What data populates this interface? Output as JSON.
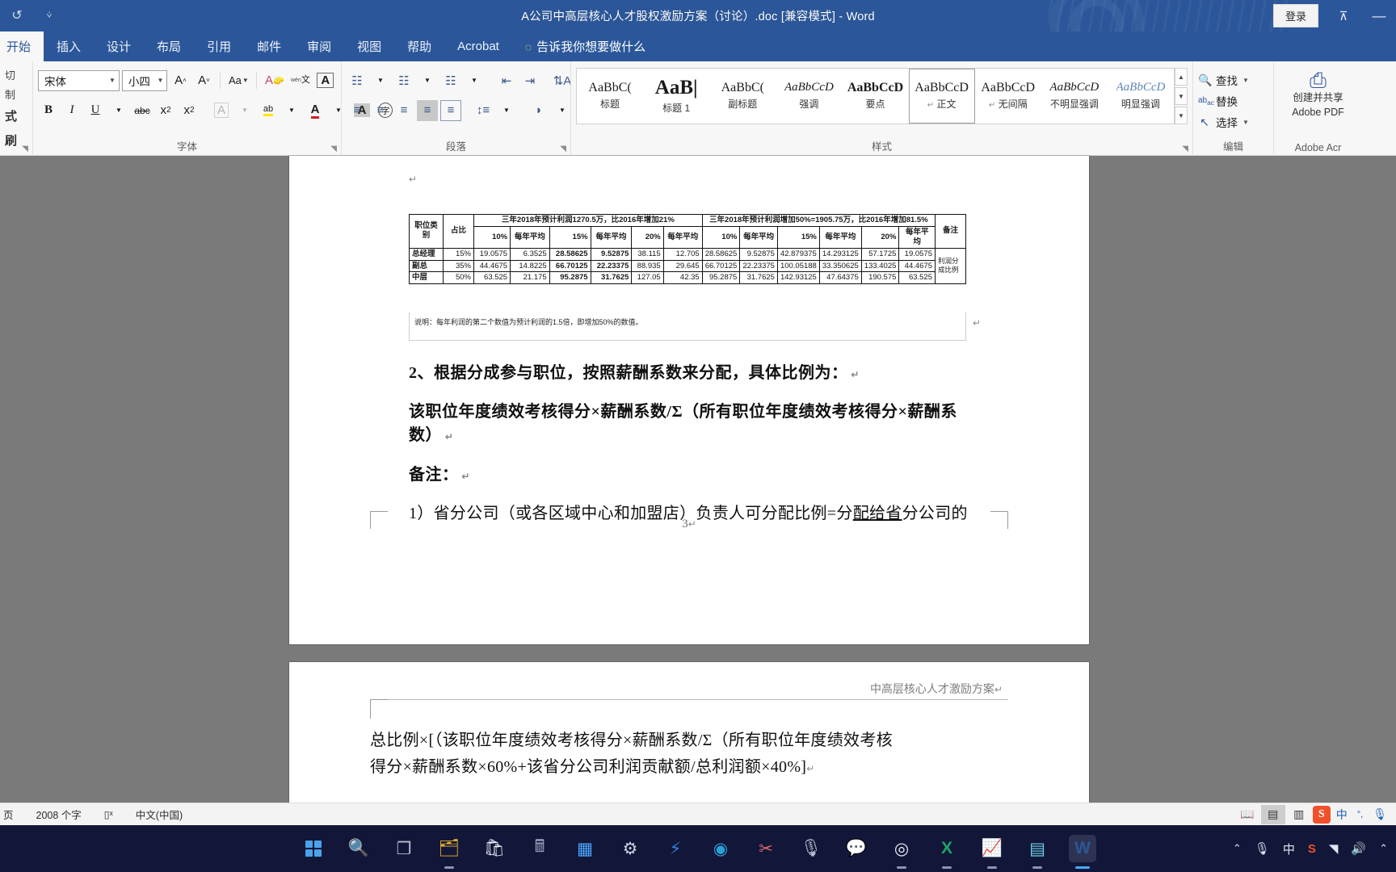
{
  "titlebar": {
    "document_title": "A公司中高层核心人才股权激励方案（讨论）.doc [兼容模式]  -  Word",
    "signin_label": "登录",
    "qat": [
      {
        "name": "undo",
        "glyph": "↺"
      },
      {
        "name": "customize",
        "glyph": "⩒"
      }
    ],
    "ribbon_display_glyph": "⊼",
    "minimize_glyph": "—"
  },
  "tabs": [
    {
      "label": "开始",
      "active": true
    },
    {
      "label": "插入",
      "active": false
    },
    {
      "label": "设计",
      "active": false
    },
    {
      "label": "布局",
      "active": false
    },
    {
      "label": "引用",
      "active": false
    },
    {
      "label": "邮件",
      "active": false
    },
    {
      "label": "审阅",
      "active": false
    },
    {
      "label": "视图",
      "active": false
    },
    {
      "label": "帮助",
      "active": false
    },
    {
      "label": "Acrobat",
      "active": false
    }
  ],
  "tell_me": "告诉我你想要做什么",
  "ribbon": {
    "clipboard": {
      "label": "",
      "items": [
        "切",
        "制",
        "式刷"
      ]
    },
    "font": {
      "label": "字体",
      "font_name": "宋体",
      "font_size": "小四",
      "buttons": [
        {
          "name": "grow-font",
          "glyph": "A˄"
        },
        {
          "name": "shrink-font",
          "glyph": "A˅"
        },
        {
          "name": "change-case",
          "glyph": "Aa"
        },
        {
          "name": "clear-formatting",
          "glyph": "A"
        },
        {
          "name": "phonetic-guide",
          "glyph": "文"
        },
        {
          "name": "character-border",
          "glyph": "A"
        },
        {
          "name": "bold",
          "glyph": "B"
        },
        {
          "name": "italic",
          "glyph": "I"
        },
        {
          "name": "underline",
          "glyph": "U"
        },
        {
          "name": "strikethrough",
          "glyph": "abc"
        },
        {
          "name": "subscript",
          "glyph": "x₂"
        },
        {
          "name": "superscript",
          "glyph": "x²"
        },
        {
          "name": "text-effects",
          "glyph": "A"
        },
        {
          "name": "text-highlight-color",
          "glyph": "ab"
        },
        {
          "name": "font-color",
          "glyph": "A"
        },
        {
          "name": "character-shading",
          "glyph": "A"
        },
        {
          "name": "enclose-characters",
          "glyph": "字"
        }
      ]
    },
    "paragraph": {
      "label": "段落",
      "buttons": [
        {
          "name": "bullets",
          "glyph": "☰"
        },
        {
          "name": "numbering",
          "glyph": "☰"
        },
        {
          "name": "multilevel-list",
          "glyph": "☰"
        },
        {
          "name": "decrease-indent",
          "glyph": "⇤"
        },
        {
          "name": "increase-indent",
          "glyph": "⇥"
        },
        {
          "name": "sort",
          "glyph": "A↓"
        },
        {
          "name": "show-formatting-marks",
          "glyph": "¶"
        },
        {
          "name": "align-left",
          "glyph": "≡"
        },
        {
          "name": "align-center",
          "glyph": "≡"
        },
        {
          "name": "align-right",
          "glyph": "≡"
        },
        {
          "name": "justify",
          "glyph": "≡"
        },
        {
          "name": "distribute",
          "glyph": "≡"
        },
        {
          "name": "line-spacing",
          "glyph": "↕"
        },
        {
          "name": "shading",
          "glyph": "◗"
        },
        {
          "name": "borders",
          "glyph": "▢"
        }
      ]
    },
    "styles": {
      "label": "样式",
      "gallery": [
        {
          "preview": "AaBbC(",
          "name": "标题",
          "kind": "norm",
          "selected": false,
          "pilcrow": false
        },
        {
          "preview": "AaB|",
          "name": "标题 1",
          "kind": "big",
          "selected": false,
          "pilcrow": false
        },
        {
          "preview": "AaBbC(",
          "name": "副标题",
          "kind": "norm",
          "selected": false,
          "pilcrow": false
        },
        {
          "preview": "AaBbCcD",
          "name": "强调",
          "kind": "ital",
          "selected": false,
          "pilcrow": false
        },
        {
          "preview": "AaBbCcD",
          "name": "要点",
          "kind": "bolds",
          "selected": false,
          "pilcrow": false
        },
        {
          "preview": "AaBbCcD",
          "name": "正文",
          "kind": "norm",
          "selected": true,
          "pilcrow": true
        },
        {
          "preview": "AaBbCcD",
          "name": "无间隔",
          "kind": "norm",
          "selected": false,
          "pilcrow": true
        },
        {
          "preview": "AaBbCcD",
          "name": "不明显强调",
          "kind": "ital",
          "selected": false,
          "pilcrow": false
        },
        {
          "preview": "AaBbCcD",
          "name": "明显强调",
          "kind": "blueital",
          "selected": false,
          "pilcrow": false
        }
      ]
    },
    "editing": {
      "label": "编辑",
      "items": [
        {
          "icon": "search-icon",
          "glyph": "🔍",
          "label": "查找",
          "caret": true
        },
        {
          "icon": "replace-icon",
          "glyph": "ab",
          "label": "替换",
          "caret": false
        },
        {
          "icon": "select-icon",
          "glyph": "↖",
          "label": "选择",
          "caret": true
        }
      ]
    },
    "adobe": {
      "label": "Adobe Acr",
      "line1": "创建并共享",
      "line2": "Adobe PDF"
    }
  },
  "document": {
    "table": {
      "headers": {
        "col_category": "职位类别",
        "col_share": "占比",
        "group_left": "三年2018年预计利润1270.5万，比2016年增加21%",
        "group_right": "三年2018年预计利润增加50%=1905.75万，比2016年增加81.5%",
        "col_remark": "备注",
        "remark_sub": "利润分成比例",
        "sub_cols": [
          "10%",
          "每年平均",
          "15%",
          "每年平均",
          "20%",
          "每年平均"
        ]
      },
      "rows": [
        {
          "category": "总经理",
          "share": "15%",
          "left": [
            "19.0575",
            "6.3525",
            "28.58625",
            "9.52875",
            "38.115",
            "12.705"
          ],
          "right": [
            "28.58625",
            "9.52875",
            "42.879375",
            "14.293125",
            "57.1725",
            "19.0575"
          ]
        },
        {
          "category": "副总",
          "share": "35%",
          "left": [
            "44.4675",
            "14.8225",
            "66.70125",
            "22.23375",
            "88.935",
            "29.645"
          ],
          "right": [
            "66.70125",
            "22.23375",
            "100.05188",
            "33.350625",
            "133.4025",
            "44.4675"
          ]
        },
        {
          "category": "中层",
          "share": "50%",
          "left": [
            "63.525",
            "21.175",
            "95.2875",
            "31.7625",
            "127.05",
            "42.35"
          ],
          "right": [
            "95.2875",
            "31.7625",
            "142.93125",
            "47.64375",
            "190.575",
            "63.525"
          ]
        }
      ],
      "note": "说明：每年利润的第二个数值为预计利润的1.5倍，即增加50%的数值。"
    },
    "paragraphs": [
      {
        "name": "heading-2",
        "text": "2、根据分成参与职位，按照薪酬系数来分配，具体比例为：",
        "bold": true
      },
      {
        "name": "formula-1",
        "text": "该职位年度绩效考核得分×薪酬系数/Σ（所有职位年度绩效考核得分×薪酬系数）",
        "bold": true
      },
      {
        "name": "remark-heading",
        "text": "备注：",
        "bold": true
      },
      {
        "name": "remark-item-1a",
        "text": "1）省分公司（或各区域中心和加盟店）负责人可分配比例=分",
        "bold": false
      },
      {
        "name": "remark-item-1b",
        "text": "配给省",
        "bold": false,
        "underline": true
      },
      {
        "name": "remark-item-1c",
        "text": "分公司的",
        "bold": false
      }
    ],
    "page_number": "3",
    "page2_header": "中高层核心人才激励方案",
    "page2_paragraphs": [
      {
        "name": "formula-2-line1",
        "text": "总比例×[（该职位年度绩效考核得分×薪酬系数/Σ（所有职位年度绩效考核"
      },
      {
        "name": "formula-2-line2",
        "text": "得分×薪酬系数×60%+该省分公司利润贡献额/总利润额×40%]"
      }
    ],
    "pilcrow": "↵"
  },
  "statusbar": {
    "page_label": "页",
    "word_count": "2008 个字",
    "proofing_icon": "spell-check-icon",
    "language": "中文(中国)",
    "views": [
      {
        "name": "read-mode",
        "glyph": "▤",
        "active": false
      },
      {
        "name": "print-layout",
        "glyph": "▤",
        "active": true
      },
      {
        "name": "web-layout",
        "glyph": "▤",
        "active": false
      }
    ],
    "ime_mode": "中",
    "ime_punct": "°,",
    "mic_icon": "microphone-icon"
  },
  "taskbar": {
    "icons": [
      {
        "name": "start-button",
        "glyph": "",
        "kind": "windows",
        "running": false
      },
      {
        "name": "search-icon",
        "glyph": "🔍",
        "kind": "search",
        "running": false
      },
      {
        "name": "task-view-icon",
        "glyph": "❐",
        "kind": "taskview",
        "running": false
      },
      {
        "name": "file-explorer-icon",
        "glyph": "🗀",
        "kind": "explorer",
        "running": true
      },
      {
        "name": "microsoft-store-icon",
        "glyph": "🛍",
        "kind": "store",
        "running": false
      },
      {
        "name": "calculator-icon",
        "glyph": "🖩",
        "kind": "calc",
        "running": false
      },
      {
        "name": "media-app-icon",
        "glyph": "▦",
        "kind": "media",
        "running": false
      },
      {
        "name": "settings-icon",
        "glyph": "⚙",
        "kind": "settings",
        "running": false
      },
      {
        "name": "thunder-app-icon",
        "glyph": "⚡",
        "kind": "thunder",
        "running": false
      },
      {
        "name": "edge-browser-icon",
        "glyph": "◉",
        "kind": "edge",
        "running": false
      },
      {
        "name": "snipping-tool-icon",
        "glyph": "✂",
        "kind": "snip",
        "running": false
      },
      {
        "name": "recorder-icon",
        "glyph": "🎙",
        "kind": "mic",
        "running": false
      },
      {
        "name": "wechat-icon",
        "glyph": "💬",
        "kind": "wechat",
        "running": false
      },
      {
        "name": "obs-studio-icon",
        "glyph": "◎",
        "kind": "obs",
        "running": true
      },
      {
        "name": "excel-icon",
        "glyph": "X",
        "kind": "excel",
        "running": true
      },
      {
        "name": "chart-app-icon",
        "glyph": "📈",
        "kind": "chart",
        "running": true
      },
      {
        "name": "notepad-icon",
        "glyph": "▤",
        "kind": "notepad",
        "running": true
      },
      {
        "name": "word-icon",
        "glyph": "W",
        "kind": "word",
        "running": true,
        "active": true
      }
    ],
    "tray": {
      "chevron": "⌃",
      "mic": "🎙",
      "ime": "中",
      "sogou": "S",
      "wifi": "◥",
      "volume": "🔊",
      "expand": "⌃"
    }
  }
}
